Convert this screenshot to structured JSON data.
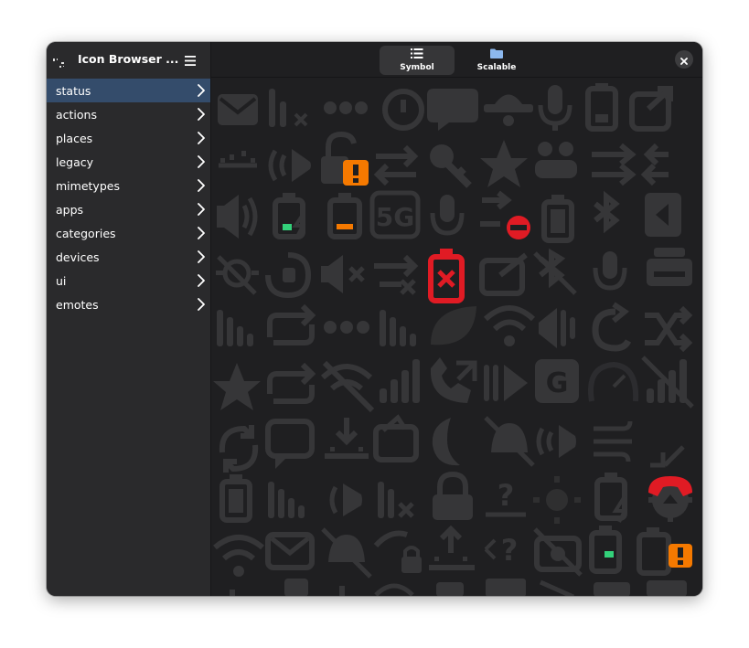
{
  "sidebar": {
    "title": "Icon Browser ...",
    "app_icon": "icon-browser-app-icon",
    "menu_icon": "hamburger-menu-icon",
    "categories": [
      {
        "label": "status",
        "active": true
      },
      {
        "label": "actions",
        "active": false
      },
      {
        "label": "places",
        "active": false
      },
      {
        "label": "legacy",
        "active": false
      },
      {
        "label": "mimetypes",
        "active": false
      },
      {
        "label": "apps",
        "active": false
      },
      {
        "label": "categories",
        "active": false
      },
      {
        "label": "devices",
        "active": false
      },
      {
        "label": "ui",
        "active": false
      },
      {
        "label": "emotes",
        "active": false
      }
    ]
  },
  "header": {
    "view_switcher": [
      {
        "label": "Symbol",
        "icon": "list-icon",
        "active": true
      },
      {
        "label": "Scalable",
        "icon": "folder-icon",
        "active": false
      }
    ],
    "close_icon": "close-icon"
  },
  "colors": {
    "window_bg": "#1f1f21",
    "sidebar_bg": "#2a2a2c",
    "selected_row": "#344c6b",
    "dim_icon": "#363638",
    "warning_orange": "#f57900",
    "error_red": "#e01b24",
    "success_green": "#33d17a"
  },
  "icons": [
    "mail-icon",
    "network-cellular-none-icon",
    "view-more-icon",
    "alarm-icon",
    "chat-bubble-icon",
    "airplane-mode-icon",
    "microphone-icon",
    "battery-low-icon",
    "send-to-icon",
    "brightness-low-icon",
    "speaker-playing-icon",
    "lock-warning-icon",
    "transfer-arrows-icon",
    "key-icon",
    "starred-icon",
    "user-group-icon",
    "arrows-right-icon",
    "arrows-left-icon",
    "volume-high-icon",
    "battery-charging-low-icon",
    "battery-caution-icon",
    "network-5g-icon",
    "microphone-disabled-icon",
    "call-blocked-icon",
    "battery-empty-icon",
    "bluetooth-icon",
    "media-skip-backward-icon",
    "night-light-disabled-icon",
    "rotation-lock-icon",
    "volume-muted-icon",
    "transfer-error-icon",
    "battery-missing-icon",
    "mail-send-icon",
    "bluetooth-disabled-icon",
    "microphone-sensitivity-icon",
    "printer-icon",
    "signal-strength-icon",
    "repeat-icon",
    "view-more-horizontal-icon",
    "signal-weak-icon",
    "leaf-icon",
    "wifi-icon",
    "speaker-icon",
    "rotate-icon",
    "shuffle-icon",
    "star-half-icon",
    "sync-icon",
    "wifi-disabled-icon",
    "signal-excellent-icon",
    "phone-missed-icon",
    "audio-playing-icon",
    "network-g-icon",
    "speedometer-icon",
    "signal-disabled-icon",
    "refresh-icon",
    "message-icon",
    "download-icon",
    "mail-refresh-icon",
    "moon-icon",
    "notification-disabled-icon",
    "audio-volume-icon",
    "weather-windy-icon",
    "call-end-icon",
    "battery-full-icon",
    "network-bars-icon",
    "speaker-low-icon",
    "cellular-disabled-icon",
    "lock-icon",
    "help-question-icon",
    "brightness-icon",
    "battery-charging-icon",
    "settings-upload-icon",
    "wifi-low-icon",
    "mail-unread-icon",
    "notifications-disabled-icon",
    "lock-rotation-icon",
    "sunrise-icon",
    "help-transfer-icon",
    "camera-disabled-icon",
    "battery-charging-level-icon",
    "battery-warning-icon"
  ]
}
